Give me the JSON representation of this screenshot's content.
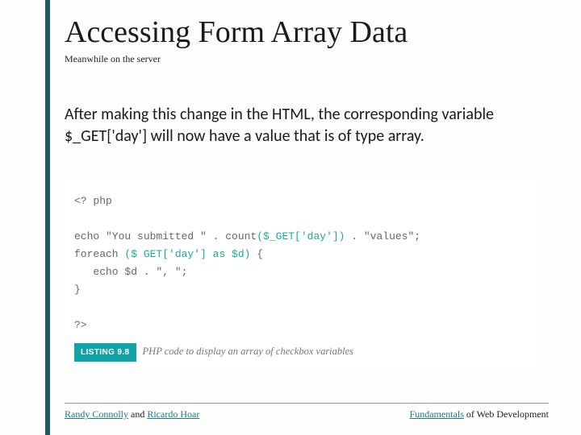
{
  "title": "Accessing Form Array Data",
  "subtitle": "Meanwhile on the server",
  "body": "After making this change in the HTML, the corresponding variable $_GET['day'] will now have a value that is of type array.",
  "code": {
    "l1": "<? php",
    "l2_a": "echo \"You submitted \" . count",
    "l2_b": "($_GET['day'])",
    "l2_c": " . \"values\";",
    "l3_a": "foreach ",
    "l3_b": "($ GET['day'] as $d)",
    "l3_c": " {",
    "l4": "   echo $d . \", \";",
    "l5": "}",
    "l6": "?>"
  },
  "listing": {
    "badge": "LISTING 9.8",
    "caption": "PHP code to display an array of checkbox variables"
  },
  "footer": {
    "left_a": "Randy Connolly",
    "left_mid": " and ",
    "left_b": "Ricardo Hoar",
    "right_a": "Fundamentals",
    "right_b": " of Web Development"
  }
}
